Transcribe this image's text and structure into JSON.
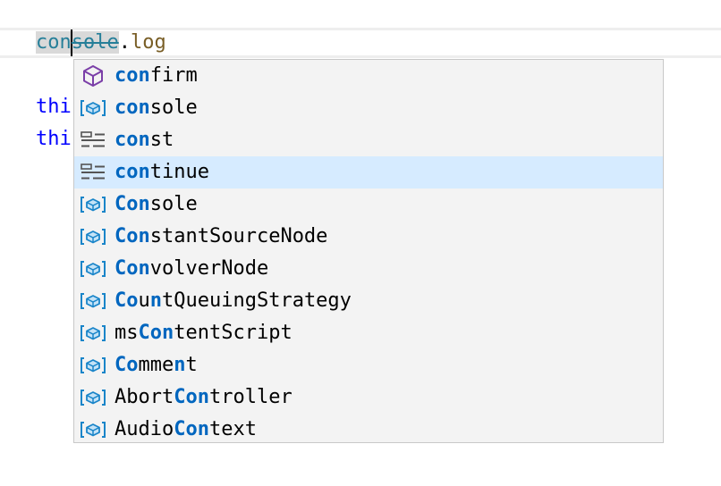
{
  "editor": {
    "line1": {
      "console_pre": "con",
      "console_post": "sole",
      "dot": ".",
      "method": "log"
    },
    "line3": {
      "kw": "thi"
    },
    "line4": {
      "kw": "thi"
    }
  },
  "suggestions": [
    {
      "icon": "module-icon",
      "parts": [
        {
          "t": "con",
          "h": true
        },
        {
          "t": "firm",
          "h": false
        }
      ],
      "selected": false
    },
    {
      "icon": "variable-icon",
      "parts": [
        {
          "t": "con",
          "h": true
        },
        {
          "t": "sole",
          "h": false
        }
      ],
      "selected": false
    },
    {
      "icon": "keyword-icon",
      "parts": [
        {
          "t": "con",
          "h": true
        },
        {
          "t": "st",
          "h": false
        }
      ],
      "selected": false
    },
    {
      "icon": "keyword-icon",
      "parts": [
        {
          "t": "con",
          "h": true
        },
        {
          "t": "tinue",
          "h": false
        }
      ],
      "selected": true
    },
    {
      "icon": "variable-icon",
      "parts": [
        {
          "t": "Con",
          "h": true
        },
        {
          "t": "sole",
          "h": false
        }
      ],
      "selected": false
    },
    {
      "icon": "variable-icon",
      "parts": [
        {
          "t": "Con",
          "h": true
        },
        {
          "t": "stantSourceNode",
          "h": false
        }
      ],
      "selected": false
    },
    {
      "icon": "variable-icon",
      "parts": [
        {
          "t": "Con",
          "h": true
        },
        {
          "t": "volverNode",
          "h": false
        }
      ],
      "selected": false
    },
    {
      "icon": "variable-icon",
      "parts": [
        {
          "t": "Co",
          "h": true
        },
        {
          "t": "u",
          "h": false
        },
        {
          "t": "n",
          "h": true
        },
        {
          "t": "tQueuingStrategy",
          "h": false
        }
      ],
      "selected": false
    },
    {
      "icon": "variable-icon",
      "parts": [
        {
          "t": "ms",
          "h": false
        },
        {
          "t": "Con",
          "h": true
        },
        {
          "t": "tentScript",
          "h": false
        }
      ],
      "selected": false
    },
    {
      "icon": "variable-icon",
      "parts": [
        {
          "t": "Co",
          "h": true
        },
        {
          "t": "mme",
          "h": false
        },
        {
          "t": "n",
          "h": true
        },
        {
          "t": "t",
          "h": false
        }
      ],
      "selected": false
    },
    {
      "icon": "variable-icon",
      "parts": [
        {
          "t": "Abort",
          "h": false
        },
        {
          "t": "Con",
          "h": true
        },
        {
          "t": "troller",
          "h": false
        }
      ],
      "selected": false
    },
    {
      "icon": "variable-icon",
      "parts": [
        {
          "t": "Audio",
          "h": false
        },
        {
          "t": "Con",
          "h": true
        },
        {
          "t": "text",
          "h": false
        }
      ],
      "selected": false
    }
  ],
  "colors": {
    "accent": "#0066bf",
    "selected_bg": "#d6ebff",
    "module_icon": "#7b3fa8",
    "variable_icon": "#1a85c9",
    "keyword_icon": "#555555"
  }
}
